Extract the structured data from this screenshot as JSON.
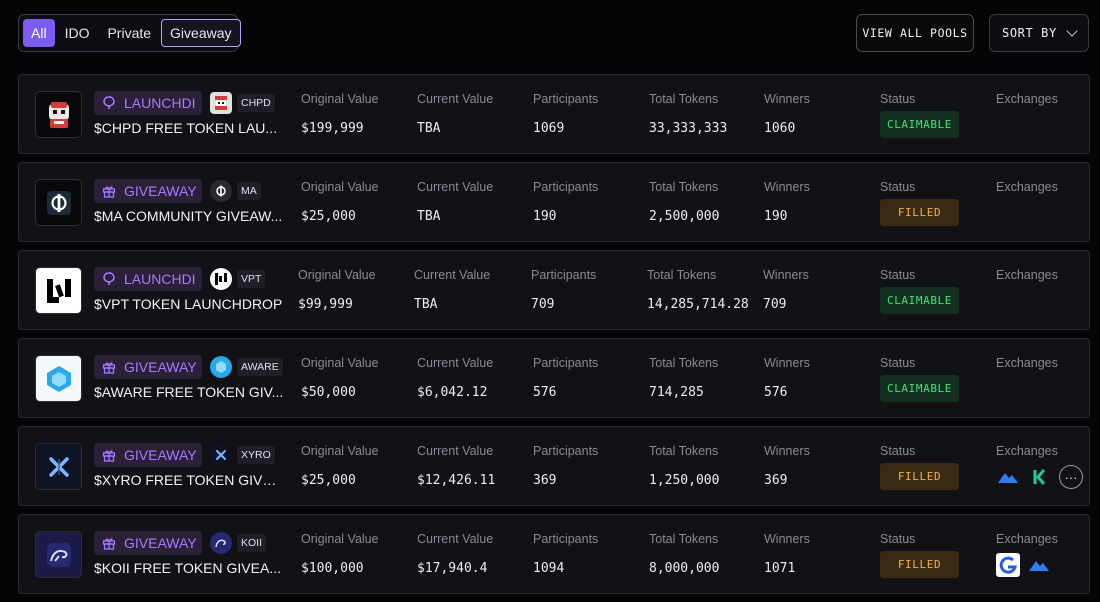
{
  "filters": {
    "tabs": [
      "All",
      "IDO",
      "Private",
      "Giveaway"
    ],
    "active": "All",
    "highlighted": "Giveaway"
  },
  "toolbar": {
    "view_all_label": "VIEW ALL POOLS",
    "sort_label": "SORT BY"
  },
  "columns": {
    "original_value": "Original Value",
    "current_value": "Current Value",
    "participants": "Participants",
    "total_tokens": "Total Tokens",
    "winners": "Winners",
    "status": "Status",
    "exchanges": "Exchanges"
  },
  "colors": {
    "accent": "#7c5cf0",
    "badge_purple": "#a57cff",
    "claimable": "#46e07a",
    "filled": "#f0b24a"
  },
  "pools": [
    {
      "type": "LAUNCHDROP",
      "type_display": "LAUNCHDI",
      "type_icon": "balloon-icon",
      "token_symbol": "CHPD",
      "name": "$CHPD FREE TOKEN LAUNCHDROP",
      "name_display": "$CHPD FREE TOKEN LAU...",
      "original_value": "$199,999",
      "current_value": "TBA",
      "participants": "1069",
      "total_tokens": "33,333,333",
      "winners": "1060",
      "status": "CLAIMABLE",
      "exchanges": []
    },
    {
      "type": "GIVEAWAY",
      "type_display": "GIVEAWAY",
      "type_icon": "gift-icon",
      "token_symbol": "MA",
      "name": "$MA COMMUNITY GIVEAWAY",
      "name_display": "$MA COMMUNITY GIVEAW...",
      "original_value": "$25,000",
      "current_value": "TBA",
      "participants": "190",
      "total_tokens": "2,500,000",
      "winners": "190",
      "status": "FILLED",
      "exchanges": []
    },
    {
      "type": "LAUNCHDROP",
      "type_display": "LAUNCHDI",
      "type_icon": "balloon-icon",
      "token_symbol": "VPT",
      "name": "$VPT TOKEN LAUNCHDROP",
      "name_display": "$VPT TOKEN LAUNCHDROP",
      "original_value": "$99,999",
      "current_value": "TBA",
      "participants": "709",
      "total_tokens": "14,285,714.28",
      "winners": "709",
      "status": "CLAIMABLE",
      "exchanges": []
    },
    {
      "type": "GIVEAWAY",
      "type_display": "GIVEAWAY",
      "type_icon": "gift-icon",
      "token_symbol": "AWARE",
      "name": "$AWARE FREE TOKEN GIVEAWAY",
      "name_display": "$AWARE FREE TOKEN GIV...",
      "original_value": "$50,000",
      "current_value": "$6,042.12",
      "participants": "576",
      "total_tokens": "714,285",
      "winners": "576",
      "status": "CLAIMABLE",
      "exchanges": []
    },
    {
      "type": "GIVEAWAY",
      "type_display": "GIVEAWAY",
      "type_icon": "gift-icon",
      "token_symbol": "XYRO",
      "name": "$XYRO FREE TOKEN GIVEAWAY",
      "name_display": "$XYRO FREE TOKEN GIVEA...",
      "original_value": "$25,000",
      "current_value": "$12,426.11",
      "participants": "369",
      "total_tokens": "1,250,000",
      "winners": "369",
      "status": "FILLED",
      "exchanges": [
        "blue-mountain-exchange-icon",
        "kucoin-exchange-icon",
        "more-icon"
      ]
    },
    {
      "type": "GIVEAWAY",
      "type_display": "GIVEAWAY",
      "type_icon": "gift-icon",
      "token_symbol": "KOII",
      "name": "$KOII FREE TOKEN GIVEAWAY",
      "name_display": "$KOII FREE TOKEN GIVEA...",
      "original_value": "$100,000",
      "current_value": "$17,940.4",
      "participants": "1094",
      "total_tokens": "8,000,000",
      "winners": "1071",
      "status": "FILLED",
      "exchanges": [
        "gate-exchange-icon",
        "blue-mountain-exchange-icon"
      ]
    }
  ]
}
